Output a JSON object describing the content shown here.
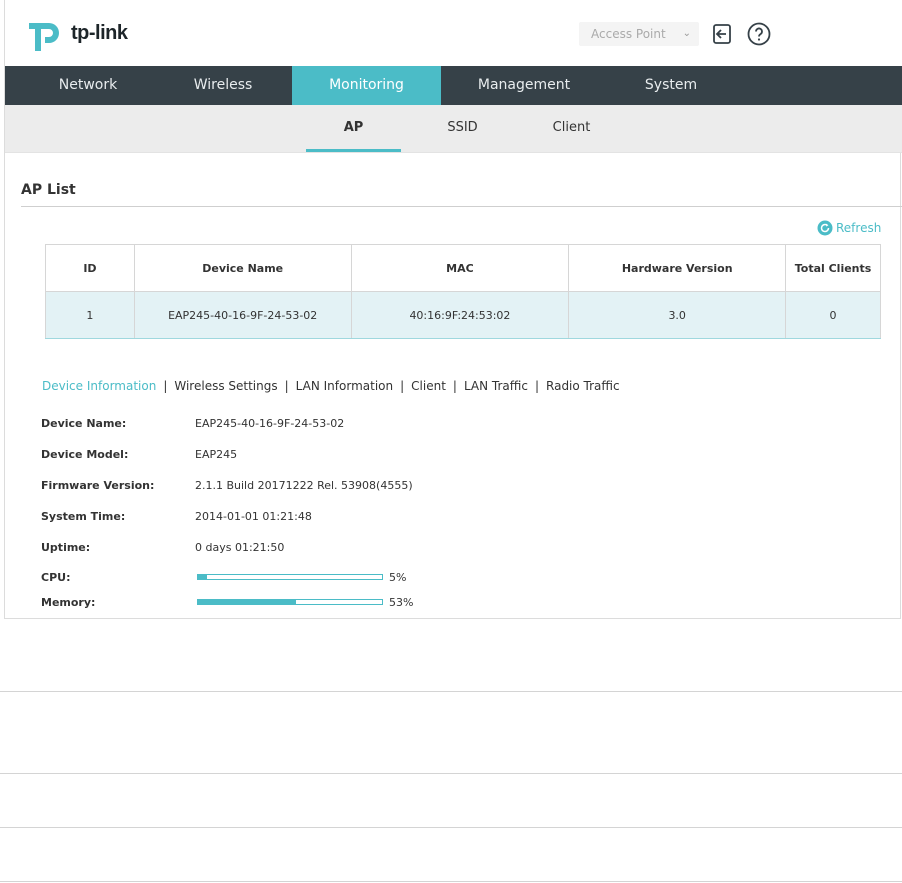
{
  "header": {
    "brand": "tp-link",
    "mode_select": "Access Point"
  },
  "nav": {
    "items": [
      {
        "label": "Network"
      },
      {
        "label": "Wireless"
      },
      {
        "label": "Monitoring"
      },
      {
        "label": "Management"
      },
      {
        "label": "System"
      }
    ],
    "active": "Monitoring"
  },
  "subnav": {
    "items": [
      {
        "label": "AP"
      },
      {
        "label": "SSID"
      },
      {
        "label": "Client"
      }
    ],
    "active": "AP"
  },
  "ap_list": {
    "title": "AP List",
    "refresh_label": "Refresh",
    "columns": [
      "ID",
      "Device Name",
      "MAC",
      "Hardware Version",
      "Total Clients"
    ],
    "rows": [
      [
        "1",
        "EAP245-40-16-9F-24-53-02",
        "40:16:9F:24:53:02",
        "3.0",
        "0"
      ]
    ]
  },
  "detail_tabs": {
    "items": [
      "Device Information",
      "Wireless Settings",
      "LAN Information",
      "Client",
      "LAN Traffic",
      "Radio Traffic"
    ],
    "active": "Device Information",
    "separator": "|"
  },
  "device_info": {
    "device_name_label": "Device Name:",
    "device_name": "EAP245-40-16-9F-24-53-02",
    "device_model_label": "Device Model:",
    "device_model": "EAP245",
    "firmware_label": "Firmware Version:",
    "firmware": "2.1.1 Build 20171222 Rel. 53908(4555)",
    "system_time_label": "System Time:",
    "system_time": "2014-01-01 01:21:48",
    "uptime_label": "Uptime:",
    "uptime": "0 days 01:21:50",
    "cpu_label": "CPU:",
    "cpu_percent": 5,
    "cpu_text": "5%",
    "memory_label": "Memory:",
    "memory_percent": 53,
    "memory_text": "53%"
  },
  "colors": {
    "accent": "#4bbcc7",
    "nav_bg": "#364148",
    "subnav_bg": "#ececec",
    "selected_row": "#e3f2f5"
  }
}
